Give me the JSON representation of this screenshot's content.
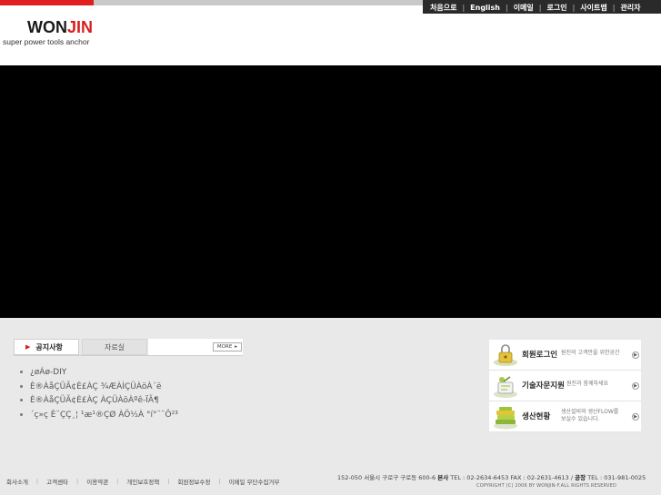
{
  "top_nav": {
    "items": [
      "처음으로",
      "English",
      "이메일",
      "로그인",
      "사이트맵",
      "관리자"
    ],
    "separator": "|"
  },
  "logo": {
    "part1": "WON",
    "part2": "JIN",
    "tagline": "super power tools anchor"
  },
  "tabs": {
    "active": "공지사항",
    "inactive": "자료실",
    "more_label": "MORE"
  },
  "notices": [
    "¿øÁø-DIY",
    "È®ÀåÇÜÃ¢È£ÀÇ ¾ÆÀÌÇÜÀöÀ´ë",
    "È®ÀåÇÜÃ¢È£ÀÇ ÀÇÜÀöÀºê-ÏÃ¶",
    "´ç»ç È¨ÇÇ¸¦ ¹æ¹®ÇØ ÀÖ½À °í°¨¨Ô²³"
  ],
  "quick_links": [
    {
      "title": "회원로그인",
      "desc": [
        "원진의 고객만을 위한공간"
      ],
      "icon": "lock-icon"
    },
    {
      "title": "기술자문지원",
      "desc": [
        "원진과 함께하세요"
      ],
      "icon": "tech-support-icon"
    },
    {
      "title": "생산현황",
      "desc": [
        "생산설비와 생산FLOW를",
        "보실수 있습니다."
      ],
      "icon": "books-icon"
    }
  ],
  "footer": {
    "nav": [
      "회사소개",
      "고객센타",
      "이용약관",
      "개인보호정책",
      "회원정보수정",
      "이메일 무단수집거부"
    ],
    "address": "152-050 서울시 구로구 구로동 600-6",
    "hq_label": "본사",
    "hq_phone": "TEL : 02-2634-6453   FAX : 02-2631-4613 /",
    "factory_label": "공장",
    "factory_phone": "TEL : 031-981-0025",
    "copyright": "COPYRIGHT (C) 2006 BY WONJIN-F.ALL RIGHTS RESERVED"
  },
  "colors": {
    "brand_red": "#d81e1e",
    "top_dark": "#2a2a2a",
    "content_bg": "#e9e9e9"
  }
}
